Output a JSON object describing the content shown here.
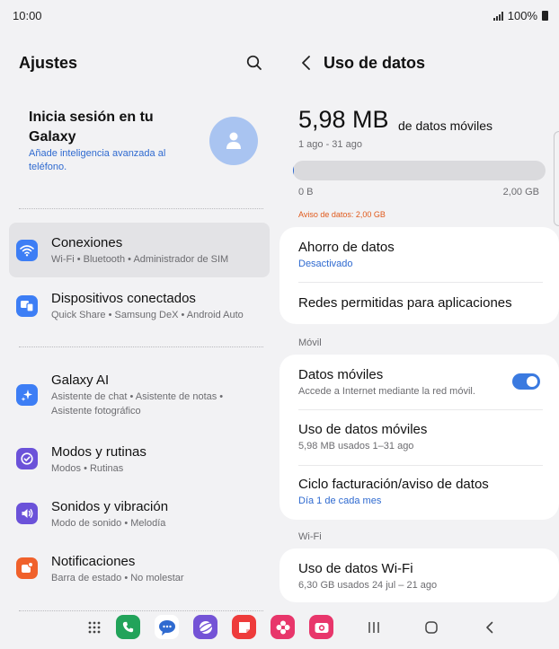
{
  "status_bar": {
    "time": "10:00",
    "battery": "100%"
  },
  "settings": {
    "title": "Ajustes",
    "account": {
      "title": "Inicia sesión en tu Galaxy",
      "subtitle": "Añade inteligencia avanzada al teléfono."
    },
    "items": [
      {
        "title": "Conexiones",
        "subtitle": "Wi-Fi • Bluetooth • Administrador de SIM",
        "icon": "wifi-icon",
        "color": "#3d7ef5"
      },
      {
        "title": "Dispositivos conectados",
        "subtitle": "Quick Share • Samsung DeX • Android Auto",
        "icon": "devices-icon",
        "color": "#3d7ef5"
      },
      {
        "title": "Galaxy AI",
        "subtitle": "Asistente de chat • Asistente de notas • Asistente fotográfico",
        "icon": "sparkle-icon",
        "color": "#3d7ef5"
      },
      {
        "title": "Modos y rutinas",
        "subtitle": "Modos • Rutinas",
        "icon": "check-circle-icon",
        "color": "#6b52d9"
      },
      {
        "title": "Sonidos y vibración",
        "subtitle": "Modo de sonido • Melodía",
        "icon": "speaker-icon",
        "color": "#6b52d9"
      },
      {
        "title": "Notificaciones",
        "subtitle": "Barra de estado • No molestar",
        "icon": "notification-icon",
        "color": "#f0612b"
      }
    ]
  },
  "data_usage": {
    "title": "Uso de datos",
    "amount": "5,98 MB",
    "amount_suffix": "de datos móviles",
    "period": "1 ago - 31 ago",
    "used_fraction": 0.003,
    "min_label": "0 B",
    "max_label": "2,00 GB",
    "warning": "Aviso de datos: 2,00 GB",
    "saver": {
      "title": "Ahorro de datos",
      "status": "Desactivado"
    },
    "allowed_apps": "Redes permitidas para aplicaciones",
    "mobile_section": "Móvil",
    "mobile_data": {
      "title": "Datos móviles",
      "subtitle": "Accede a Internet mediante la red móvil.",
      "enabled": true
    },
    "mobile_usage": {
      "title": "Uso de datos móviles",
      "subtitle": "5,98 MB usados 1–31 ago"
    },
    "billing": {
      "title": "Ciclo facturación/aviso de datos",
      "subtitle": "Día 1 de cada mes"
    },
    "wifi_section": "Wi-Fi",
    "wifi_usage": {
      "title": "Uso de datos Wi-Fi",
      "subtitle": "6,30 GB usados 24 jul – 21 ago"
    }
  },
  "nav_bar": {
    "apps": [
      {
        "name": "phone",
        "color": "#22a35a"
      },
      {
        "name": "messages",
        "color": "#ffffff"
      },
      {
        "name": "internet",
        "color": "#7453d6"
      },
      {
        "name": "notes",
        "color": "#ee3b3b"
      },
      {
        "name": "gallery",
        "color": "#e8366b"
      },
      {
        "name": "camera",
        "color": "#e8366b"
      }
    ]
  }
}
